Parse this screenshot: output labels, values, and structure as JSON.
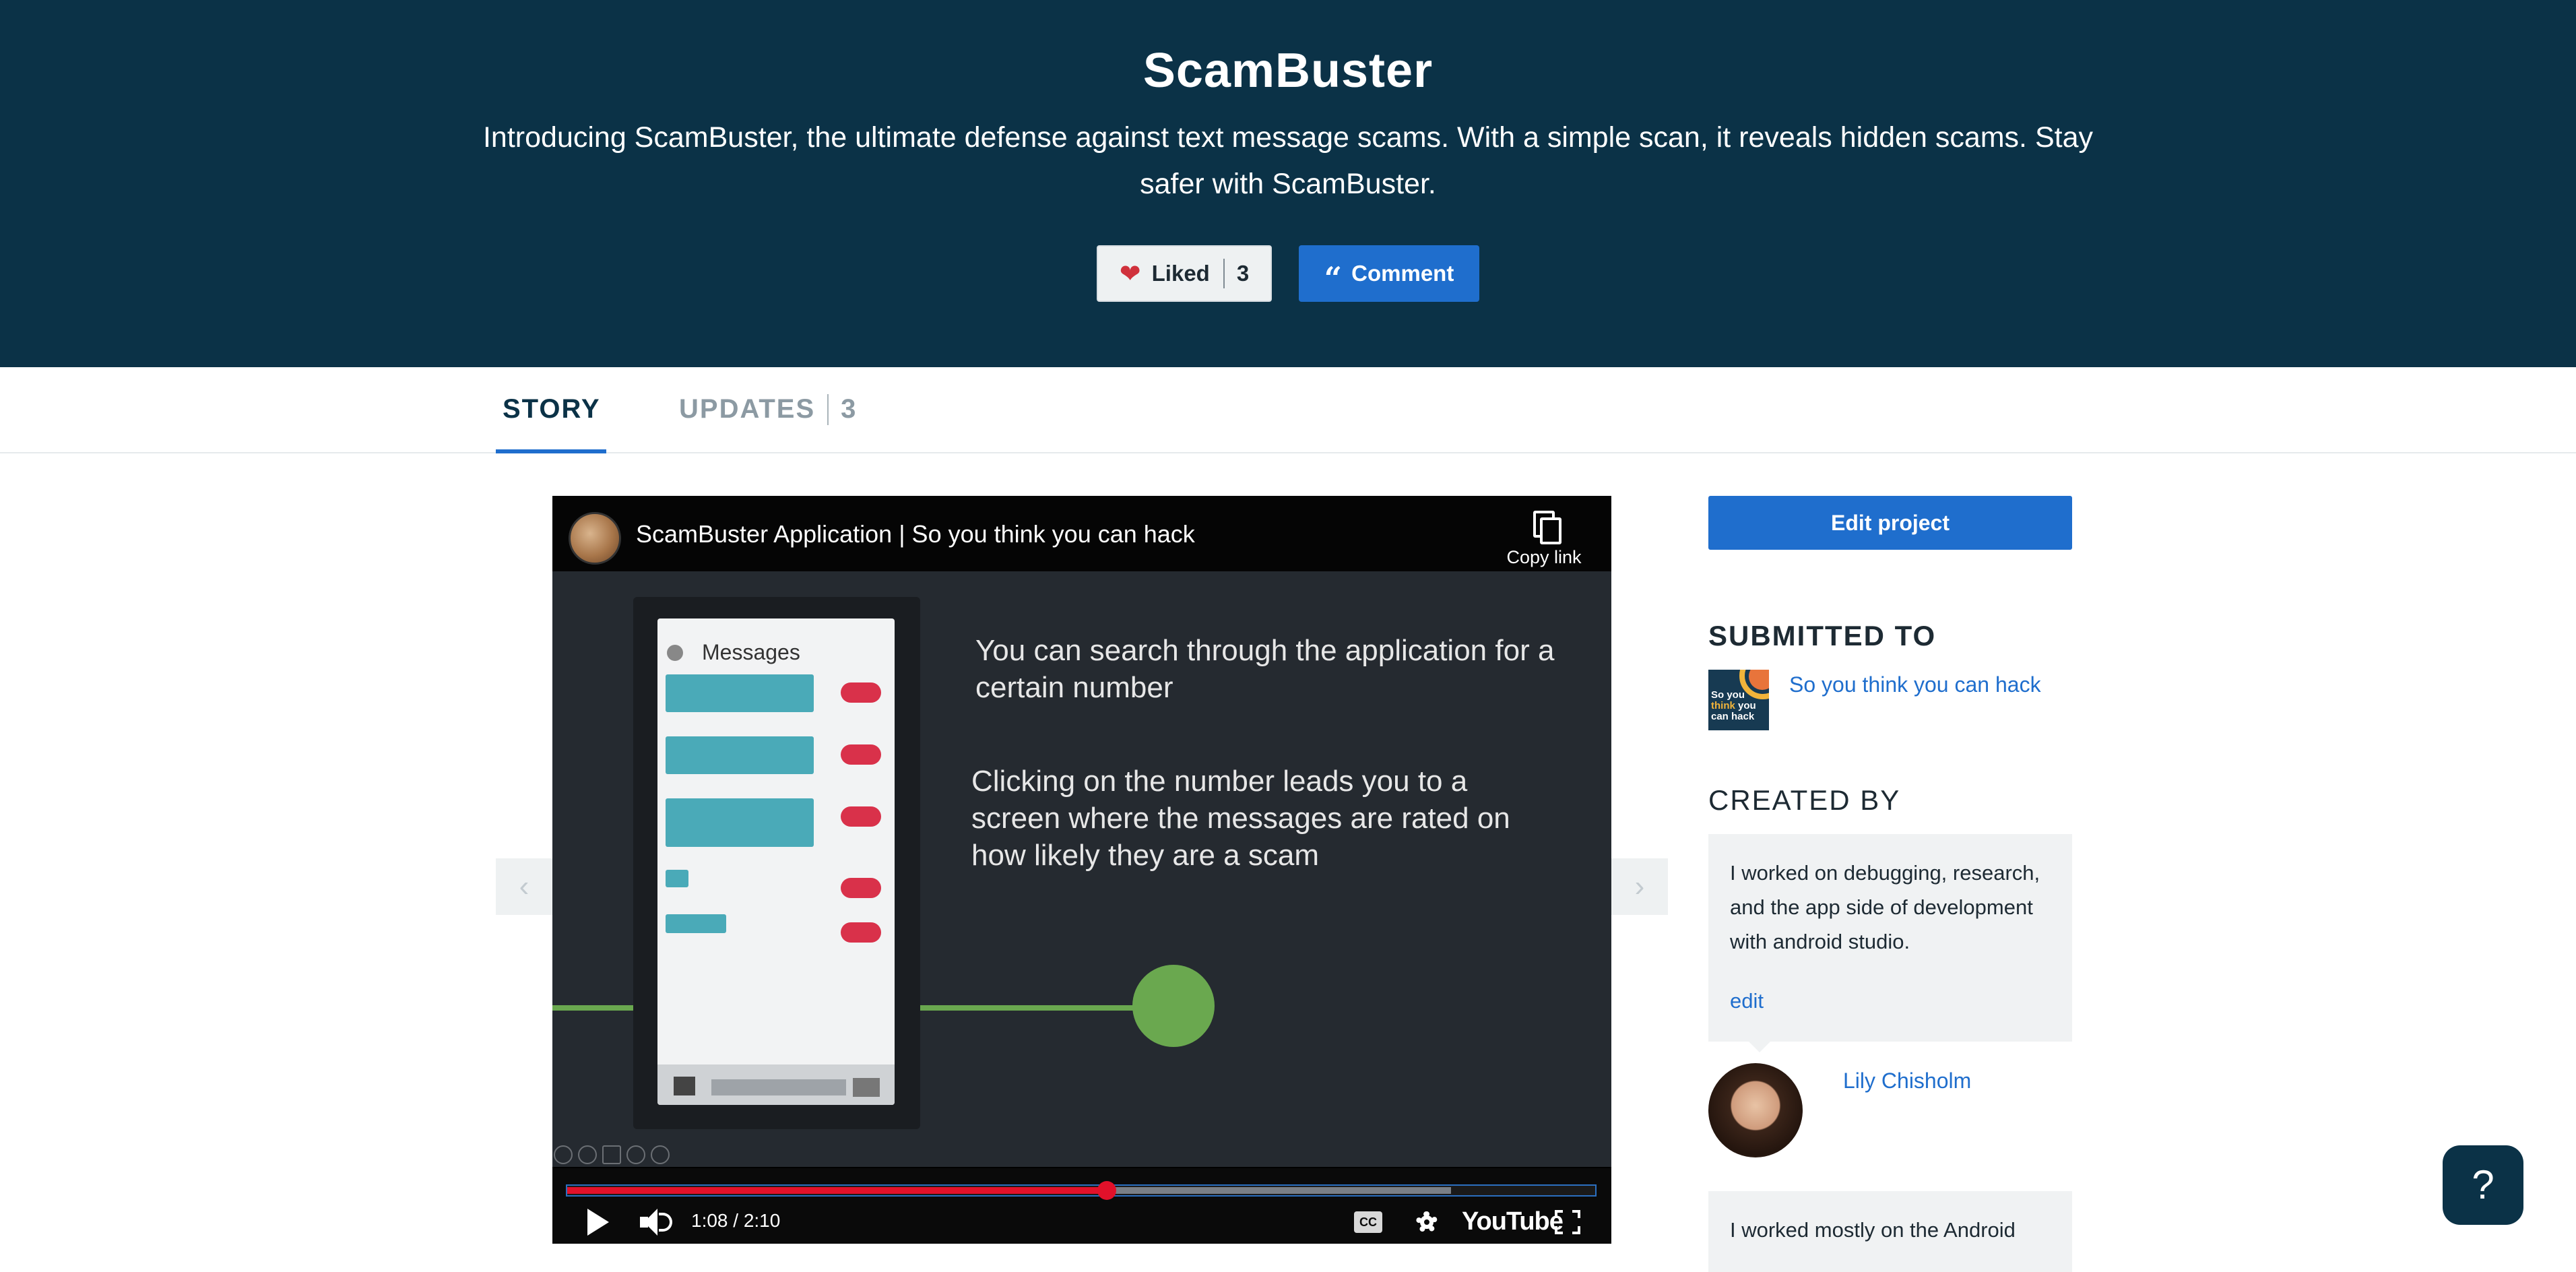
{
  "hero": {
    "title": "ScamBuster",
    "tagline": "Introducing ScamBuster, the ultimate defense against text message scams. With a simple scan, it reveals hidden scams. Stay safer with ScamBuster.",
    "like_label": "Liked",
    "like_count": "3",
    "comment_label": "Comment",
    "colors": {
      "background": "#0b3247",
      "primary": "#1f6ecd",
      "heart": "#d0313c"
    }
  },
  "tabs": [
    {
      "label": "STORY",
      "active": true
    },
    {
      "label": "UPDATES",
      "count": "3",
      "active": false
    }
  ],
  "gallery": {
    "prev_icon": "chevron-left-icon",
    "next_icon": "chevron-right-icon",
    "video": {
      "title": "ScamBuster Application | So you think you can hack",
      "copy_link_label": "Copy link",
      "time": "1:08 / 2:10",
      "progress_fraction": 0.525,
      "buffered_fraction": 0.86,
      "cc_label": "CC",
      "brand": "YouTube",
      "slide": {
        "heading_1": "You can search through the application for a certain number",
        "heading_2": "Clicking on the number leads you to a screen where the messages are rated on how likely they are a scam",
        "phone_title": "Messages"
      }
    }
  },
  "sidebar": {
    "edit_button": "Edit project",
    "submitted_heading": "SUBMITTED TO",
    "challenge": {
      "name": "So you think you can hack",
      "thumb_line1": "So you",
      "thumb_line2": "think",
      "thumb_line3": "you",
      "thumb_line4": "can hack"
    },
    "created_heading": "CREATED BY",
    "members": [
      {
        "contribution": "I worked on debugging, research, and the app side of development with android studio.",
        "edit_label": "edit",
        "name": "Lily Chisholm"
      },
      {
        "contribution": "I worked mostly on the Android"
      }
    ]
  },
  "help": {
    "label": "?"
  }
}
